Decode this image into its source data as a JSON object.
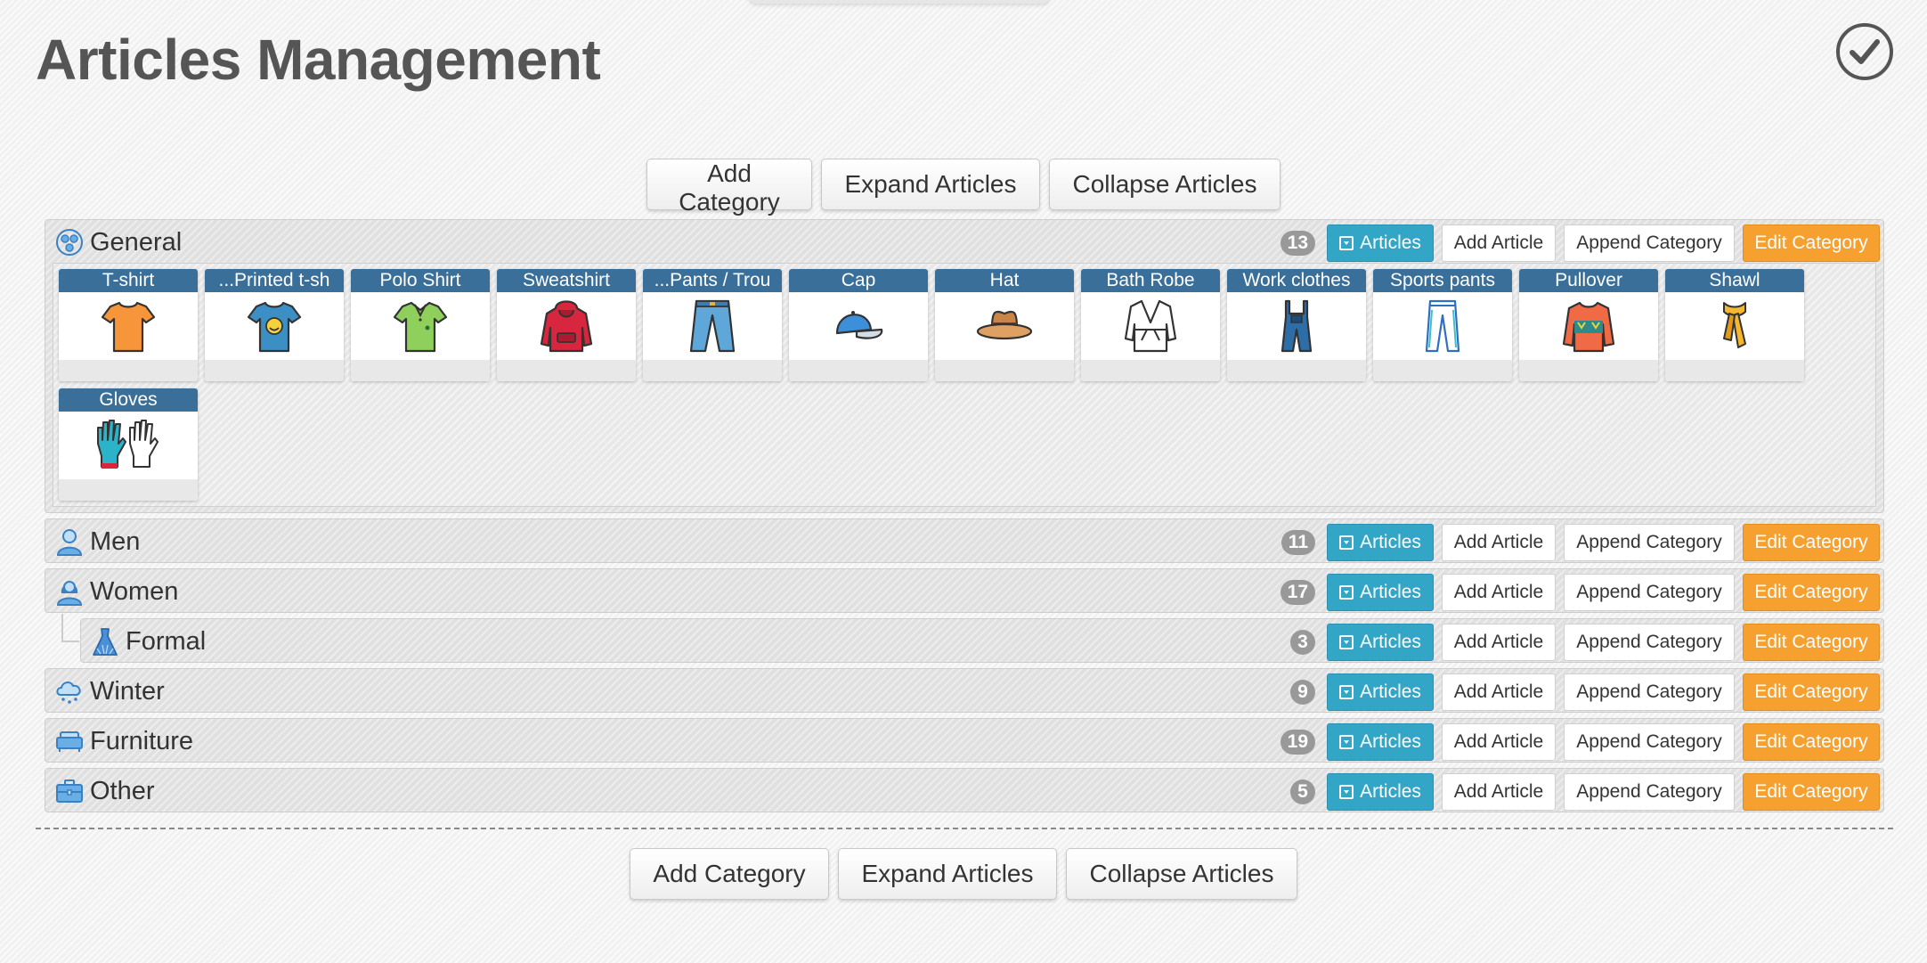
{
  "page": {
    "title": "Articles Management"
  },
  "toolbar": {
    "add_category": "Add Category",
    "expand_articles": "Expand Articles",
    "collapse_articles": "Collapse Articles"
  },
  "row_labels": {
    "articles": "Articles",
    "add_article": "Add Article",
    "append_category": "Append Category",
    "edit_category": "Edit Category"
  },
  "categories": [
    {
      "name": "General",
      "count": "13",
      "icon": "general-icon"
    },
    {
      "name": "Men",
      "count": "11",
      "icon": "man-icon"
    },
    {
      "name": "Women",
      "count": "17",
      "icon": "woman-icon"
    },
    {
      "name": "Formal",
      "count": "3",
      "icon": "dress-icon",
      "parent": "Women"
    },
    {
      "name": "Winter",
      "count": "9",
      "icon": "snow-cloud-icon"
    },
    {
      "name": "Furniture",
      "count": "19",
      "icon": "sofa-icon"
    },
    {
      "name": "Other",
      "count": "5",
      "icon": "briefcase-icon"
    }
  ],
  "general_articles": [
    {
      "name": "T-shirt",
      "icon": "tshirt-icon"
    },
    {
      "name": "...Printed t-sh",
      "icon": "printed-tshirt-icon"
    },
    {
      "name": "Polo Shirt",
      "icon": "polo-shirt-icon"
    },
    {
      "name": "Sweatshirt",
      "icon": "hoodie-icon"
    },
    {
      "name": "...Pants / Trou",
      "icon": "jeans-icon"
    },
    {
      "name": "Cap",
      "icon": "cap-icon"
    },
    {
      "name": "Hat",
      "icon": "hat-icon"
    },
    {
      "name": "Bath Robe",
      "icon": "bathrobe-icon"
    },
    {
      "name": "Work clothes",
      "icon": "overalls-icon"
    },
    {
      "name": "Sports pants",
      "icon": "sports-pants-icon"
    },
    {
      "name": "Pullover",
      "icon": "pullover-icon"
    },
    {
      "name": "Shawl",
      "icon": "scarf-icon"
    },
    {
      "name": "Gloves",
      "icon": "gloves-icon"
    }
  ],
  "colors": {
    "articles_button": "#33a6c8",
    "edit_button": "#f5a02f",
    "article_header": "#3a6f9a",
    "badge": "#999999"
  }
}
